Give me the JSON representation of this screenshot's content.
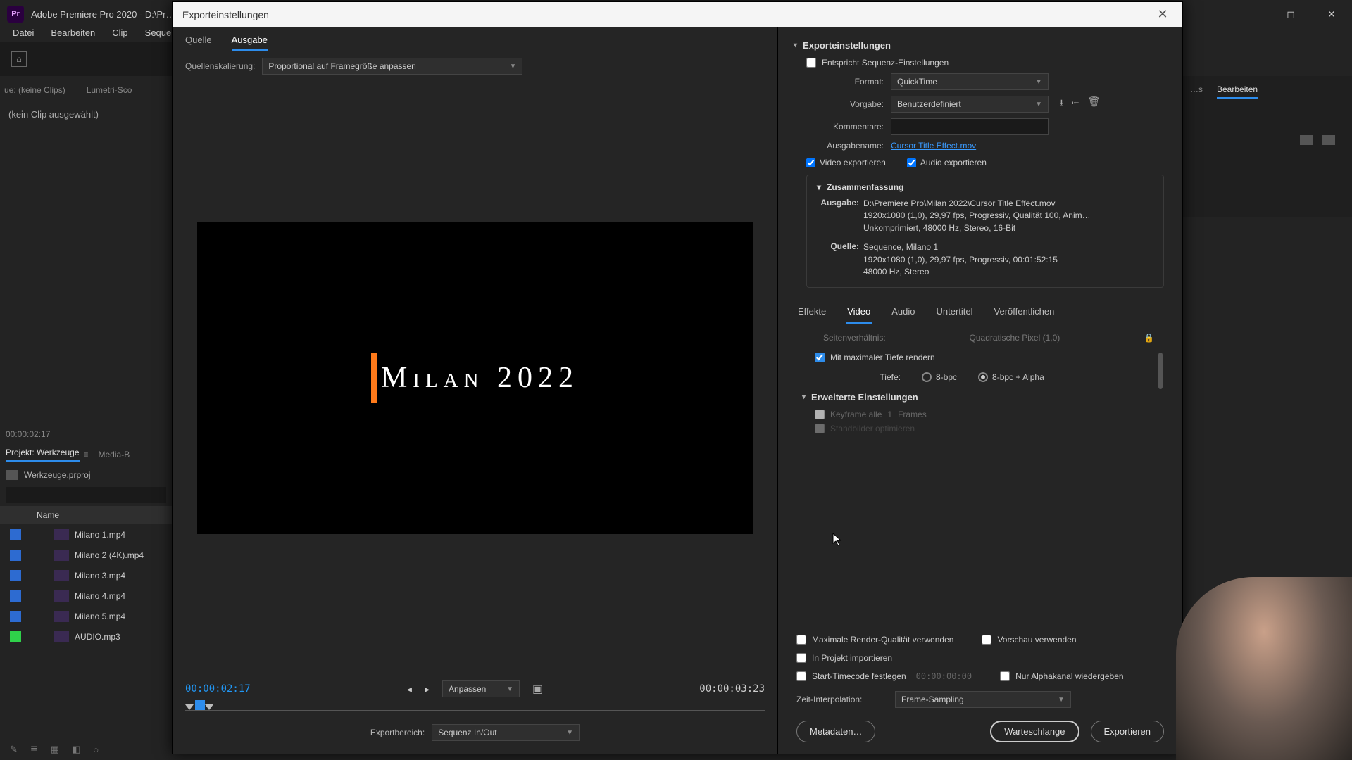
{
  "window": {
    "app_badge": "Pr",
    "title": "Adobe Premiere Pro 2020 - D:\\Pr…"
  },
  "menubar": [
    "Datei",
    "Bearbeiten",
    "Clip",
    "Sequen"
  ],
  "source_panel": {
    "tab": "ue: (keine Clips)",
    "tab2": "Lumetri-Sco",
    "noclip": "(kein Clip ausgewählt)",
    "timecode": "00:00:02:17"
  },
  "project_panel": {
    "tab": "Projekt: Werkzeuge",
    "tab2": "Media-B",
    "project_file": "Werkzeuge.prproj",
    "search_placeholder": "",
    "col_name": "Name",
    "files": [
      {
        "name": "Milano 1.mp4",
        "color": "blue"
      },
      {
        "name": "Milano 2 (4K).mp4",
        "color": "blue"
      },
      {
        "name": "Milano 3.mp4",
        "color": "blue"
      },
      {
        "name": "Milano 4.mp4",
        "color": "blue"
      },
      {
        "name": "Milano 5.mp4",
        "color": "blue"
      },
      {
        "name": "AUDIO.mp3",
        "color": "green"
      }
    ]
  },
  "right_bg": {
    "tab1": "…s",
    "tab2": "Bearbeiten"
  },
  "dialog": {
    "title": "Exporteinstellungen",
    "preview": {
      "tab_source": "Quelle",
      "tab_output": "Ausgabe",
      "scale_label": "Quellenskalierung:",
      "scale_value": "Proportional auf Framegröße anpassen",
      "video_text": "Milan 2022",
      "tc_current": "00:00:02:17",
      "tc_total": "00:00:03:23",
      "fit_label": "Anpassen",
      "range_label": "Exportbereich:",
      "range_value": "Sequenz In/Out"
    },
    "settings": {
      "section_title": "Exporteinstellungen",
      "match_seq": "Entspricht Sequenz-Einstellungen",
      "format_label": "Format:",
      "format_value": "QuickTime",
      "preset_label": "Vorgabe:",
      "preset_value": "Benutzerdefiniert",
      "comments_label": "Kommentare:",
      "outname_label": "Ausgabename:",
      "outname_value": "Cursor Title Effect.mov",
      "export_video": "Video exportieren",
      "export_audio": "Audio exportieren",
      "summary_title": "Zusammenfassung",
      "summary_out_label": "Ausgabe:",
      "summary_out_value": "D:\\Premiere Pro\\Milan 2022\\Cursor Title Effect.mov\n1920x1080 (1,0), 29,97 fps, Progressiv, Qualität 100, Anim…\nUnkomprimiert, 48000 Hz, Stereo, 16-Bit",
      "summary_src_label": "Quelle:",
      "summary_src_value": "Sequence, Milano 1\n1920x1080 (1,0), 29,97 fps, Progressiv, 00:01:52:15\n48000 Hz, Stereo",
      "enc_tabs": [
        "Effekte",
        "Video",
        "Audio",
        "Untertitel",
        "Veröffentlichen"
      ],
      "aspect_label_cut": "Seitenverhältnis:",
      "aspect_value_cut": "Quadratische Pixel (1,0)",
      "max_depth": "Mit maximaler Tiefe rendern",
      "depth_label": "Tiefe:",
      "depth_8": "8-bpc",
      "depth_8a": "8-bpc + Alpha",
      "advanced_title": "Erweiterte Einstellungen",
      "keyframe_label": "Keyframe alle",
      "keyframe_val": "1",
      "keyframe_unit": "Frames",
      "stills_label": "Standbilder optimieren",
      "max_render": "Maximale Render-Qualität verwenden",
      "use_preview": "Vorschau verwenden",
      "import_proj": "In Projekt importieren",
      "start_tc": "Start-Timecode festlegen",
      "start_tc_val": "00:00:00:00",
      "alpha_only": "Nur Alphakanal wiedergeben",
      "time_interp_label": "Zeit-Interpolation:",
      "time_interp_value": "Frame-Sampling",
      "btn_meta": "Metadaten…",
      "btn_queue": "Warteschlange",
      "btn_export": "Exportieren"
    }
  }
}
